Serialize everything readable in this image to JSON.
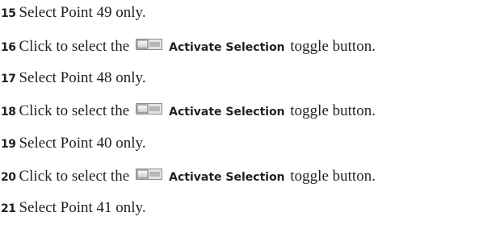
{
  "steps": [
    {
      "number": "15",
      "text": "Select Point 49 only."
    },
    {
      "number": "16",
      "before": "Click to select the",
      "ui_name": "Activate Selection",
      "after": "toggle button.",
      "icon": "activate-selection-toggle-icon"
    },
    {
      "number": "17",
      "text": "Select Point 48 only."
    },
    {
      "number": "18",
      "before": "Click to select the",
      "ui_name": "Activate Selection",
      "after": "toggle button.",
      "icon": "activate-selection-toggle-icon"
    },
    {
      "number": "19",
      "text": "Select Point 40 only."
    },
    {
      "number": "20",
      "before": "Click to select the",
      "ui_name": "Activate Selection",
      "after": "toggle button.",
      "icon": "activate-selection-toggle-icon"
    },
    {
      "number": "21",
      "text": "Select Point 41 only."
    }
  ]
}
